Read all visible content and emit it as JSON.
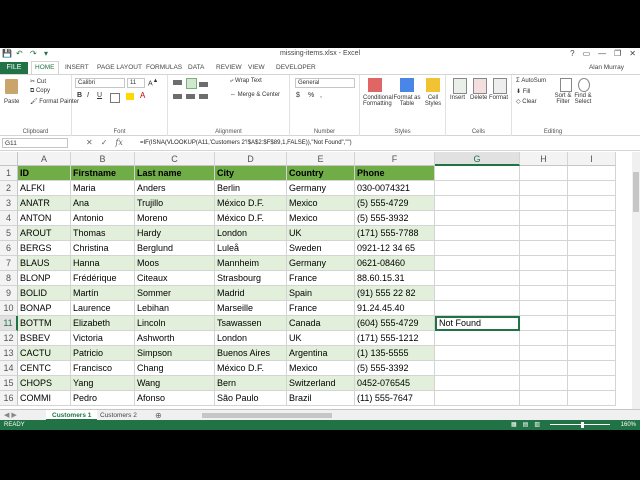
{
  "window": {
    "title": "missing-items.xlsx - Excel",
    "controls": [
      "?",
      "▭",
      "—",
      "❐",
      "✕"
    ],
    "qat": [
      "💾",
      "↶",
      "↷",
      "▾"
    ]
  },
  "tabs": {
    "file": "FILE",
    "items": [
      "HOME",
      "INSERT",
      "PAGE LAYOUT",
      "FORMULAS",
      "DATA",
      "REVIEW",
      "VIEW",
      "DEVELOPER"
    ],
    "active": "HOME",
    "user": "Alan Murray"
  },
  "ribbon": {
    "clipboard": {
      "label": "Clipboard",
      "paste": "Paste",
      "cut": "Cut",
      "copy": "Copy",
      "format_painter": "Format Painter"
    },
    "font": {
      "label": "Font",
      "name": "Calibri",
      "size": "11",
      "bold": "B",
      "italic": "I",
      "underline": "U"
    },
    "alignment": {
      "label": "Alignment",
      "wrap": "Wrap Text",
      "merge": "Merge & Center"
    },
    "number": {
      "label": "Number",
      "format": "General",
      "currency": "$",
      "percent": "%",
      "comma": ","
    },
    "styles": {
      "label": "Styles",
      "conditional": "Conditional Formatting",
      "table": "Format as Table",
      "cell": "Cell Styles"
    },
    "cells": {
      "label": "Cells",
      "insert": "Insert",
      "delete": "Delete",
      "format": "Format"
    },
    "editing": {
      "label": "Editing",
      "autosum": "AutoSum",
      "fill": "Fill",
      "clear": "Clear",
      "sort": "Sort & Filter",
      "find": "Find & Select"
    }
  },
  "formula_bar": {
    "name_box": "G11",
    "fx": "fx",
    "formula": "=IF(ISNA(VLOOKUP(A11,'Customers 2'!$A$2:$F$89,1,FALSE)),\"Not Found\",\"\")"
  },
  "grid": {
    "columns": [
      "A",
      "B",
      "C",
      "D",
      "E",
      "F",
      "G",
      "H",
      "I"
    ],
    "selected_column": "G",
    "row_numbers": [
      "1",
      "2",
      "3",
      "4",
      "5",
      "6",
      "7",
      "8",
      "9",
      "10",
      "11",
      "12",
      "13",
      "14",
      "15",
      "16"
    ],
    "selected_row": "11",
    "header": [
      "ID",
      "Firstname",
      "Last name",
      "City",
      "Country",
      "Phone"
    ],
    "rows": [
      [
        "ALFKI",
        "Maria",
        "Anders",
        "Berlin",
        "Germany",
        "030-0074321",
        ""
      ],
      [
        "ANATR",
        "Ana",
        "Trujillo",
        "México D.F.",
        "Mexico",
        "(5) 555-4729",
        ""
      ],
      [
        "ANTON",
        "Antonio",
        "Moreno",
        "México D.F.",
        "Mexico",
        "(5) 555-3932",
        ""
      ],
      [
        "AROUT",
        "Thomas",
        "Hardy",
        "London",
        "UK",
        "(171) 555-7788",
        ""
      ],
      [
        "BERGS",
        "Christina",
        "Berglund",
        "Luleå",
        "Sweden",
        "0921-12 34 65",
        ""
      ],
      [
        "BLAUS",
        "Hanna",
        "Moos",
        "Mannheim",
        "Germany",
        "0621-08460",
        ""
      ],
      [
        "BLONP",
        "Frédérique",
        "Citeaux",
        "Strasbourg",
        "France",
        "88.60.15.31",
        ""
      ],
      [
        "BOLID",
        "Martín",
        "Sommer",
        "Madrid",
        "Spain",
        "(91) 555 22 82",
        ""
      ],
      [
        "BONAP",
        "Laurence",
        "Lebihan",
        "Marseille",
        "France",
        "91.24.45.40",
        ""
      ],
      [
        "BOTTM",
        "Elizabeth",
        "Lincoln",
        "Tsawassen",
        "Canada",
        "(604) 555-4729",
        "Not Found"
      ],
      [
        "BSBEV",
        "Victoria",
        "Ashworth",
        "London",
        "UK",
        "(171) 555-1212",
        ""
      ],
      [
        "CACTU",
        "Patricio",
        "Simpson",
        "Buenos Aires",
        "Argentina",
        "(1) 135-5555",
        ""
      ],
      [
        "CENTC",
        "Francisco",
        "Chang",
        "México D.F.",
        "Mexico",
        "(5) 555-3392",
        ""
      ],
      [
        "CHOPS",
        "Yang",
        "Wang",
        "Bern",
        "Switzerland",
        "0452-076545",
        ""
      ],
      [
        "COMMI",
        "Pedro",
        "Afonso",
        "São Paulo",
        "Brazil",
        "(11) 555-7647",
        ""
      ]
    ]
  },
  "sheets": {
    "tabs": [
      "Customers 1",
      "Customers 2"
    ],
    "active": "Customers 1",
    "add": "⊕"
  },
  "status": {
    "ready": "READY",
    "zoom": "160%",
    "zoom_level_percent": 160
  },
  "colors": {
    "accent": "#217346",
    "header_fill": "#70ad47",
    "band_fill": "#e2efda"
  }
}
